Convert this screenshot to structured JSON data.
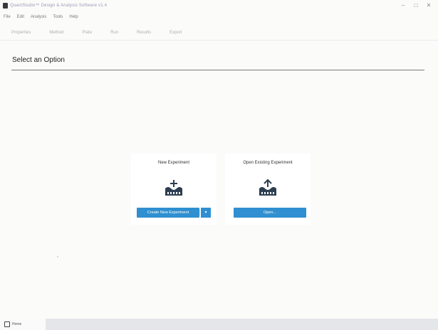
{
  "window": {
    "title": "QuantStudio™ Design & Analysis Software v1.4",
    "controls": [
      "–",
      "□",
      "✕"
    ]
  },
  "menu": {
    "items": [
      "File",
      "Edit",
      "Analysis",
      "Tools",
      "Help"
    ]
  },
  "tabs": [
    "Properties",
    "Method",
    "Plate",
    "Run",
    "Results",
    "Export"
  ],
  "main": {
    "heading": "Select an Option",
    "new_experiment": {
      "title": "New Experiment",
      "icon": "plate-add-icon",
      "button_label": "Create New Experiment",
      "dropdown_glyph": "▾"
    },
    "open_experiment": {
      "title": "Open Existing Experiment",
      "icon": "plate-open-icon",
      "button_label": "Open..."
    }
  },
  "statusbar": {
    "active_tab_label": "Home"
  },
  "colors": {
    "primary_button": "#2f8fd0",
    "background": "#fbfbfa",
    "statusbar": "#e4e6ea"
  }
}
